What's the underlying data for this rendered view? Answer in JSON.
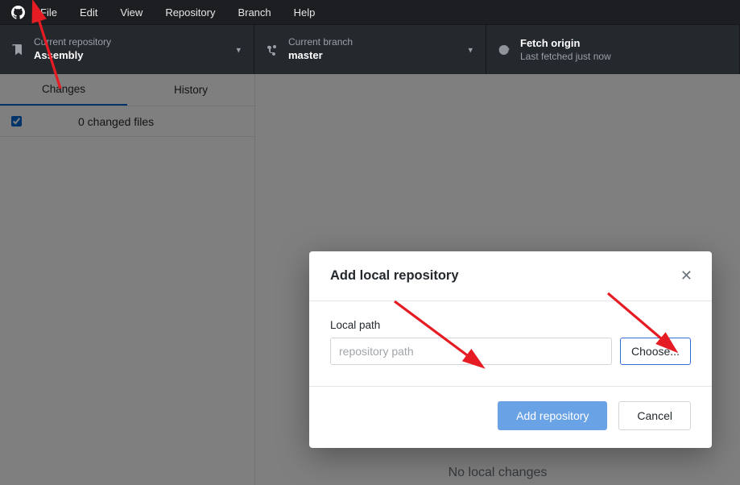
{
  "menu": {
    "items": [
      "File",
      "Edit",
      "View",
      "Repository",
      "Branch",
      "Help"
    ]
  },
  "toolbar": {
    "repo": {
      "label": "Current repository",
      "value": "Assembly"
    },
    "branch": {
      "label": "Current branch",
      "value": "master"
    },
    "fetch": {
      "label": "Fetch origin",
      "value": "Last fetched just now"
    }
  },
  "sidebar": {
    "tabs": {
      "changes": "Changes",
      "history": "History"
    },
    "changed_files_text": "0 changed files"
  },
  "main": {
    "empty_text": "No local changes"
  },
  "dialog": {
    "title": "Add local repository",
    "field_label": "Local path",
    "placeholder": "repository path",
    "choose": "Choose...",
    "add": "Add repository",
    "cancel": "Cancel"
  }
}
